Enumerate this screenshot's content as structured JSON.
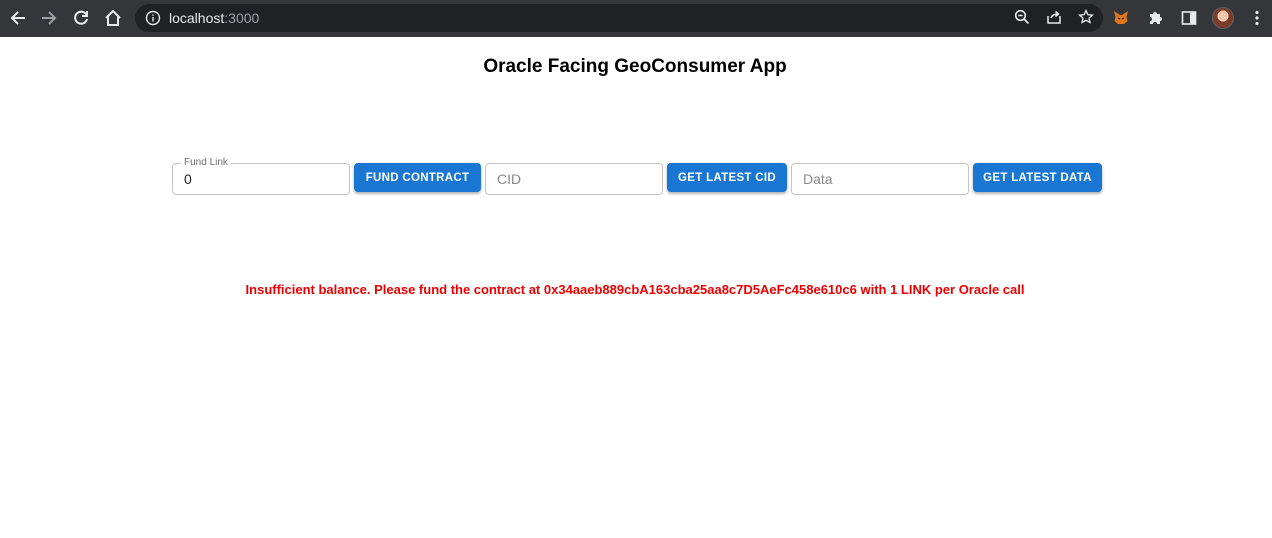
{
  "browser": {
    "url_host": "localhost",
    "url_port": ":3000",
    "icons": {
      "back": "arrow-left-icon",
      "forward": "arrow-right-icon",
      "reload": "reload-icon",
      "home": "home-icon",
      "site_info": "info-icon",
      "zoom": "zoom-icon",
      "share": "share-icon",
      "bookmark": "star-icon",
      "extension_metamask": "fox-icon",
      "extensions": "puzzle-icon",
      "side_panel": "side-panel-icon",
      "menu": "kebab-menu-icon"
    }
  },
  "page": {
    "title": "Oracle Facing GeoConsumer App"
  },
  "form": {
    "fund_link": {
      "label": "Fund Link",
      "value": "0"
    },
    "fund_button": "FUND CONTRACT",
    "cid_input": {
      "placeholder": "CID",
      "value": ""
    },
    "get_cid_button": "GET LATEST CID",
    "data_input": {
      "placeholder": "Data",
      "value": ""
    },
    "get_data_button": "GET LATEST DATA"
  },
  "error_message": "Insufficient balance. Please fund the contract at 0x34aaeb889cbA163cba25aa8c7D5AeFc458e610c6 with 1 LINK per Oracle call",
  "colors": {
    "chrome_bg": "#35363a",
    "omnibox_bg": "#202124",
    "button_blue": "#1976d2",
    "error_red": "#ee0000"
  }
}
